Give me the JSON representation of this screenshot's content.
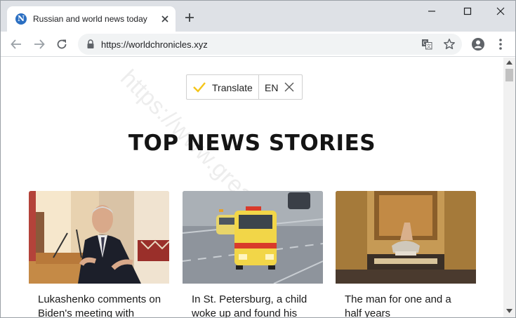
{
  "browser": {
    "tab": {
      "title": "Russian and world news today",
      "favicon_letter": "N"
    },
    "url": "https://worldchronicles.xyz"
  },
  "page": {
    "watermark": "https://www.greatis.com",
    "translate_bar": {
      "label": "Translate",
      "language": "EN"
    },
    "headline": "TOP NEWS STORIES",
    "cards": [
      {
        "title": "Lukashenko comments on Biden's meeting with"
      },
      {
        "title": "In St. Petersburg, a child woke up and found his"
      },
      {
        "title": "The man for one and a half years"
      }
    ]
  },
  "colors": {
    "tab_strip": "#dee1e6",
    "favicon": "#2b6fc2",
    "translate_check": "#f5c518"
  }
}
